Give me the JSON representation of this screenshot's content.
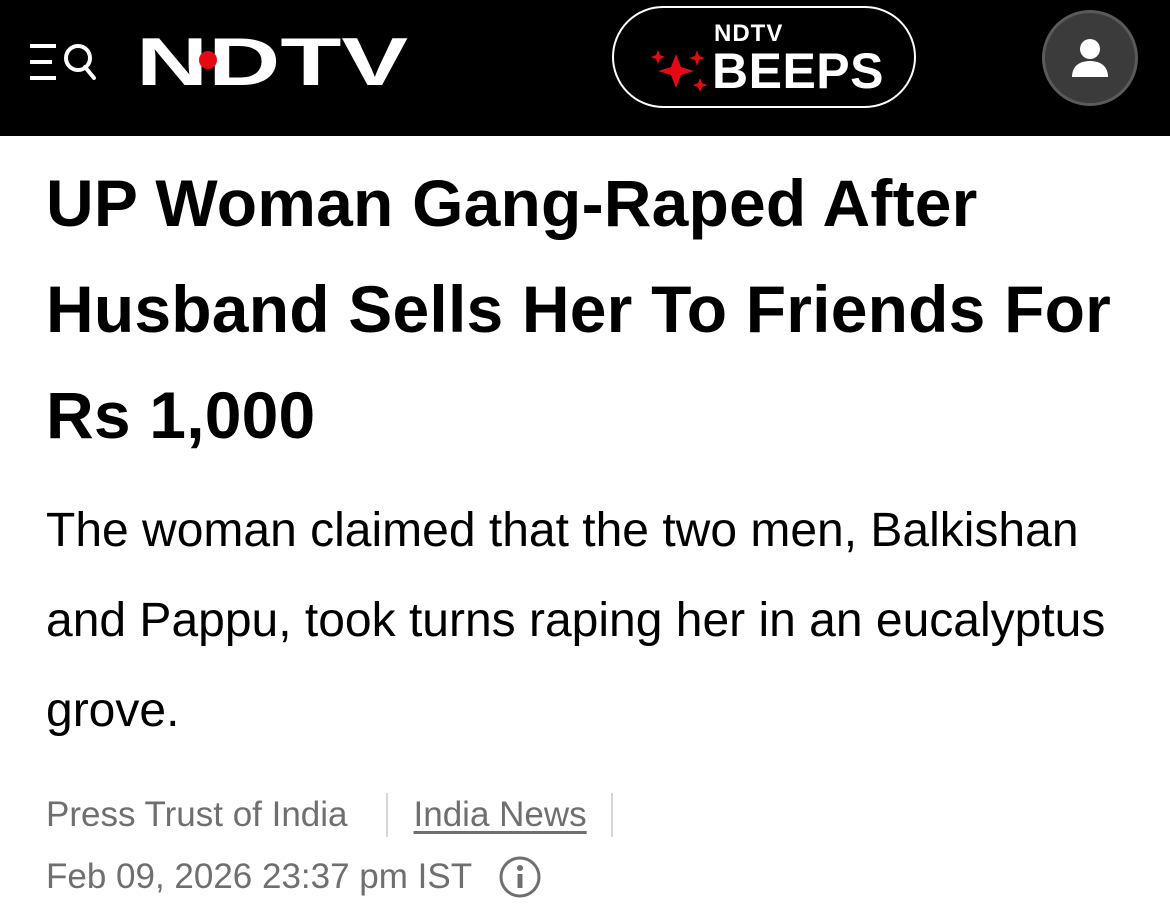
{
  "header": {
    "logo_text": "NDTV",
    "beeps_brand": "NDTV",
    "beeps_label": "BEEPS",
    "colors": {
      "background": "#000000",
      "accent": "#e50914",
      "user_button": "#3b3b3b"
    },
    "icons": {
      "menu": "menu-search-icon",
      "beeps": "sparkle-icon",
      "user": "user-icon"
    }
  },
  "article": {
    "headline": "UP Woman Gang-Raped After Husband Sells Her To Friends For Rs 1,000",
    "summary": "The woman claimed that the two men, Balkishan and Pappu, took turns raping her in an eucalyptus grove.",
    "source": "Press Trust of India",
    "category": "India News",
    "timestamp": "Feb 09, 2026 23:37 pm IST",
    "info_icon": "info-icon"
  }
}
